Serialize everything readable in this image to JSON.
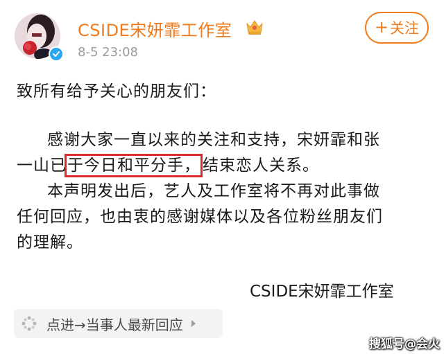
{
  "header": {
    "username": "CSIDE宋妍霏工作室",
    "timestamp": "8-5 23:08",
    "follow_label": "关注",
    "follow_plus": "+"
  },
  "post": {
    "greeting": "致所有给予关心的朋友们：",
    "p1_line1": "感谢大家一直以来的关注和支持，宋妍霏和张",
    "p1_line2_a": "一山已",
    "p1_line2_highlight": "于今日和平分手，",
    "p1_line2_b": "结束恋人关系。",
    "p2_line1": "本声明发出后，艺人及工作室将不再对此事做",
    "p2_line2": "任何回应，也由衷的感谢媒体以及各位粉丝朋友们",
    "p2_line3": "的理解。",
    "signature": "CSIDE宋妍霏工作室"
  },
  "news_link": {
    "label": "点进→当事人最新回应"
  },
  "watermark": "搜狐号@会火",
  "colors": {
    "accent": "#f07b1c",
    "highlight_box": "#d92b2b",
    "verified": "#2aa7f2",
    "muted": "#9a9a9a"
  },
  "icons": [
    "avatar",
    "verified-icon",
    "crown-badge-icon",
    "sparkle-icon",
    "chevron-right-icon"
  ]
}
